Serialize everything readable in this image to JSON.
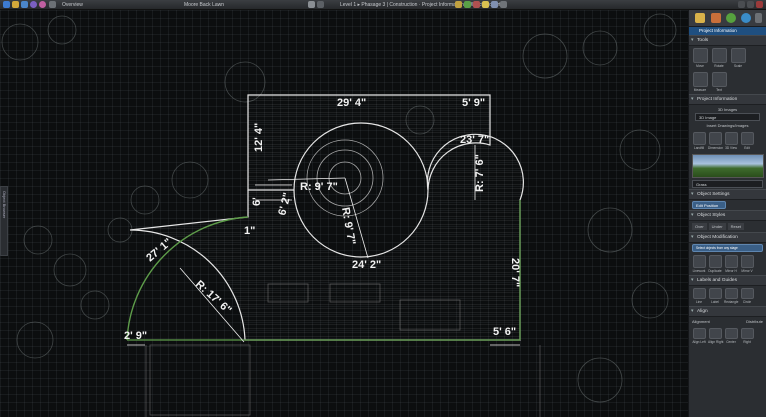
{
  "app": {
    "tabs": [
      "Overview",
      "Moore Back Lawn"
    ],
    "document_bar": "Level 1 ▸ Phasage 3 | Construction · Project Information · Object Properties"
  },
  "left_handle": {
    "label": "Object Browser"
  },
  "drawing": {
    "dimensions": {
      "top": "29' 4\"",
      "top_right": "5' 9\"",
      "mid_right": "23' 7\"",
      "left_vertical": "12' 4\"",
      "small_6": "6'",
      "small_6_2": "6' 2\"",
      "r_circle": "R: 9' 7\"",
      "r_circle_vertical": "R: 9' 7\"",
      "r_right": "R: 7' 6\"",
      "one_inch": "1\"",
      "bottom_circle": "24' 2\"",
      "left_arc": "27' 1\"",
      "r_big": "R: 17' 6\"",
      "right_vertical": "20' 7\"",
      "bottom_left": "2' 9\"",
      "bottom_right": "5' 6\""
    }
  },
  "panel": {
    "title": "Project Information",
    "sections": {
      "tools": "Tools",
      "project_information": "Project Information",
      "object_settings": "Object Settings",
      "object_styles": "Object Styles",
      "object_modification": "Object Modification",
      "labels_guides": "Labels and Guides",
      "align": "Align"
    },
    "tools_buttons": [
      "Move",
      "Rotate",
      "Scale"
    ],
    "tools_buttons2": [
      "Measure",
      "Text"
    ],
    "images_label": "3D Images",
    "images_select": "3D Image",
    "insert_label": "Insert Drawings/Images",
    "insert_buttons": [
      "Landfill",
      "Dimension",
      "3D View",
      "Edit"
    ],
    "sky_select": "Grass",
    "edit_position": "Edit Position",
    "style_options": [
      "Over",
      "Under",
      "Reset"
    ],
    "mod_select": "Select objects from any stage",
    "mod_buttons": [
      "Linework",
      "Duplicate",
      "Mirror H",
      "Mirror V"
    ],
    "mod_buttons2": [
      "Reset"
    ],
    "label_buttons": [
      "Line",
      "Label",
      "Rectangle",
      "Circle"
    ],
    "align_col1": "Alignment",
    "align_col2": "Distribute",
    "align_buttons": [
      "Align Left",
      "Align Right",
      "Center",
      "Right"
    ]
  },
  "colors": {
    "panel_accent": "#1f4f80",
    "drawing_line": "#e6e6e6",
    "boundary_green": "#5e9d4a"
  }
}
